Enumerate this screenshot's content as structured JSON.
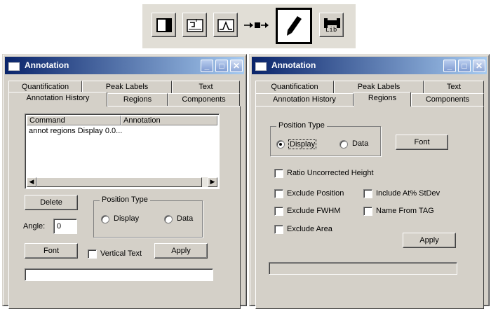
{
  "toolbar": {
    "buttons": [
      {
        "icon": "panel-icon"
      },
      {
        "icon": "display-layout-icon"
      },
      {
        "icon": "spectrum-peak-icon"
      },
      {
        "icon": "arrow-to-marker-icon"
      },
      {
        "icon": "pencil-icon",
        "selected": true
      },
      {
        "icon": "library-icon",
        "text": "Lib"
      }
    ]
  },
  "left_window": {
    "title": "Annotation",
    "tabs_back": [
      "Quantification",
      "Peak Labels",
      "Text"
    ],
    "tabs_front": [
      "Annotation History",
      "Regions",
      "Components"
    ],
    "active_tab": "Annotation History",
    "list": {
      "columns": [
        "Command",
        "Annotation"
      ],
      "rows": [
        "annot regions Display 0.0..."
      ]
    },
    "delete_label": "Delete",
    "position_type": {
      "label": "Position Type",
      "options": [
        "Display",
        "Data"
      ],
      "selected": null
    },
    "angle_label": "Angle:",
    "angle_value": "0",
    "font_label": "Font",
    "vertical_text_label": "Vertical Text",
    "apply_label": "Apply",
    "status_text": ""
  },
  "right_window": {
    "title": "Annotation",
    "tabs_back": [
      "Quantification",
      "Peak Labels",
      "Text"
    ],
    "tabs_front": [
      "Annotation History",
      "Regions",
      "Components"
    ],
    "active_tab": "Regions",
    "position_type": {
      "label": "Position Type",
      "options": [
        "Display",
        "Data"
      ],
      "selected": "Display"
    },
    "font_label": "Font",
    "checkboxes": {
      "ratio_uncorrected_height": "Ratio Uncorrected Height",
      "exclude_position": "Exclude Position",
      "include_at_stdev": "Include At% StDev",
      "exclude_fwhm": "Exclude FWHM",
      "name_from_tag": "Name From TAG",
      "exclude_area": "Exclude Area"
    },
    "apply_label": "Apply",
    "status_text": ""
  },
  "colors": {
    "titlebar_start": "#0a246a",
    "titlebar_end": "#a6caf0",
    "face": "#d4d0c8"
  }
}
